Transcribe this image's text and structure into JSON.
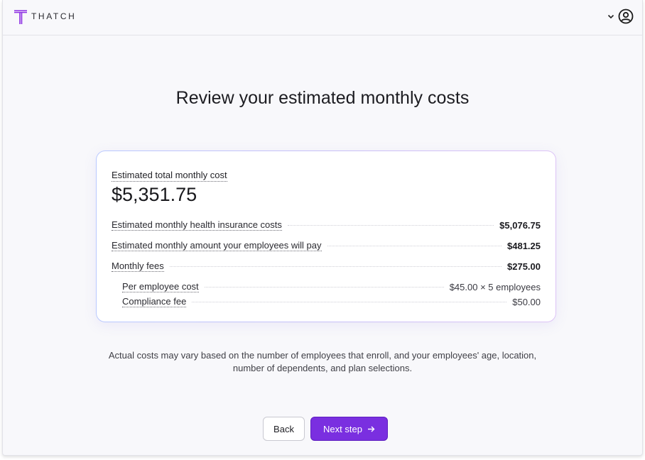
{
  "header": {
    "brand": "THATCH",
    "icons": {
      "logo": "thatch-logo-icon",
      "menu": "chevron-down-icon",
      "account": "user-circle-icon"
    },
    "logo_color": "#8a2be2"
  },
  "page": {
    "title": "Review your estimated monthly costs"
  },
  "summary": {
    "total_label": "Estimated total monthly cost",
    "total_value": "$5,351.75",
    "rows": [
      {
        "label": "Estimated monthly health insurance costs",
        "value": "$5,076.75"
      },
      {
        "label": "Estimated monthly amount your employees will pay",
        "value": "$481.25"
      },
      {
        "label": "Monthly fees",
        "value": "$275.00"
      }
    ],
    "fee_rows": [
      {
        "label": "Per employee cost",
        "value": "$45.00 × 5 employees"
      },
      {
        "label": "Compliance fee",
        "value": "$50.00"
      }
    ]
  },
  "note": {
    "line1": "Actual costs may vary based on the number of employees that enroll, and your employees' age, location,",
    "line2": "number of dependents, and plan selections."
  },
  "actions": {
    "back_label": "Back",
    "next_label": "Next step",
    "next_icon": "arrow-right-icon",
    "primary_color": "#7a2fe0"
  }
}
